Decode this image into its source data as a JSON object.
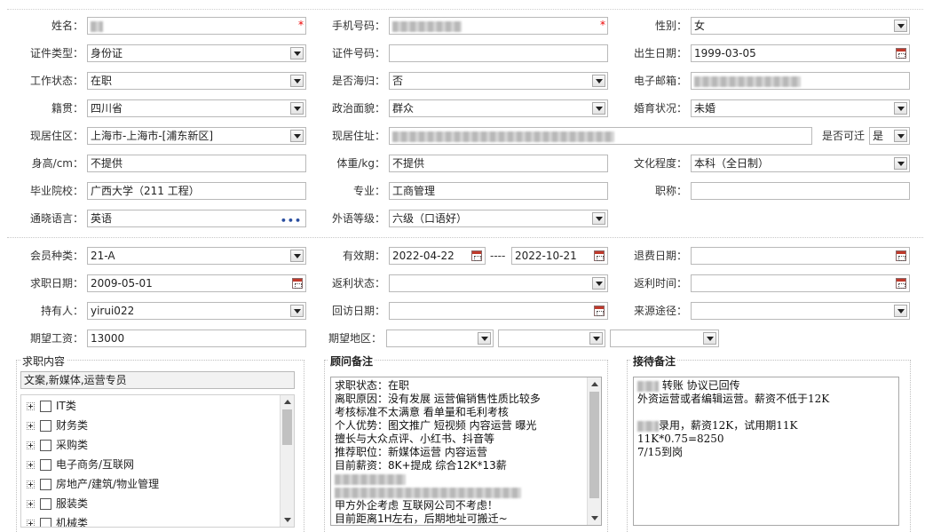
{
  "basic": {
    "name_label": "姓名：",
    "phone_label": "手机号码：",
    "gender_label": "性别：",
    "gender_value": "女",
    "id_type_label": "证件类型：",
    "id_type_value": "身份证",
    "id_no_label": "证件号码：",
    "birth_label": "出生日期：",
    "birth_value": "1999-03-05",
    "work_status_label": "工作状态：",
    "work_status_value": "在职",
    "overseas_label": "是否海归：",
    "overseas_value": "否",
    "email_label": "电子邮箱：",
    "native_label": "籍贯：",
    "native_value": "四川省",
    "political_label": "政治面貌：",
    "political_value": "群众",
    "marital_label": "婚育状况：",
    "marital_value": "未婚",
    "residence_area_label": "现居住区：",
    "residence_area_value": "上海市-上海市-[浦东新区]",
    "address_label": "现居住址：",
    "relocate_label": "是否可迁",
    "relocate_value": "是",
    "height_label": "身高/cm：",
    "height_value": "不提供",
    "weight_label": "体重/kg：",
    "weight_value": "不提供",
    "education_label": "文化程度：",
    "education_value": "本科（全日制）",
    "school_label": "毕业院校：",
    "school_value": "广西大学（211 工程）",
    "major_label": "专业：",
    "major_value": "工商管理",
    "title_label": "职称：",
    "language_label": "通晓语言：",
    "language_value": "英语",
    "language_more": "•••",
    "lang_level_label": "外语等级：",
    "lang_level_value": "六级（口语好）"
  },
  "member": {
    "type_label": "会员种类：",
    "type_value": "21-A",
    "valid_label": "有效期：",
    "valid_from": "2022-04-22",
    "valid_sep": "----",
    "valid_to": "2022-10-21",
    "refund_date_label": "退费日期：",
    "job_date_label": "求职日期：",
    "job_date_value": "2009-05-01",
    "rebate_status_label": "返利状态：",
    "rebate_time_label": "返利时间：",
    "holder_label": "持有人：",
    "holder_value": "yirui022",
    "visit_date_label": "回访日期：",
    "source_label": "来源途径：",
    "salary_label": "期望工资：",
    "salary_value": "13000",
    "region_label": "期望地区："
  },
  "job_panel": {
    "title": "求职内容",
    "summary": "文案,新媒体,运营专员",
    "tree": [
      "IT类",
      "财务类",
      "采购类",
      "电子商务/互联网",
      "房地产/建筑/物业管理",
      "服装类",
      "机械类"
    ]
  },
  "advisor_panel": {
    "title": "顾问备注",
    "lines": [
      "求职状态：在职",
      "离职原因：没有发展 运营偏销售性质比较多",
      "考核标准不太满意 看单量和毛利考核",
      "个人优势：图文推广 短视频 内容运营 曝光",
      "擅长与大众点评、小红书、抖音等",
      "推荐职位：新媒体运营 内容运营",
      "目前薪资：8K+提成 综合12K*13薪",
      "",
      "",
      "甲方外企考虑  互联网公司不考虑！",
      "目前距离1H左右，后期地址可搬迁~"
    ]
  },
  "reception_panel": {
    "title": "接待备注",
    "line1_suffix": " 转账 协议已回传",
    "line2": "外资运营或者编辑运营。薪资不低于12K",
    "line3": "",
    "line4_suffix": "录用，薪资12K，试用期11K",
    "line5": "11K*0.75=8250",
    "line6": "7/15到岗"
  }
}
